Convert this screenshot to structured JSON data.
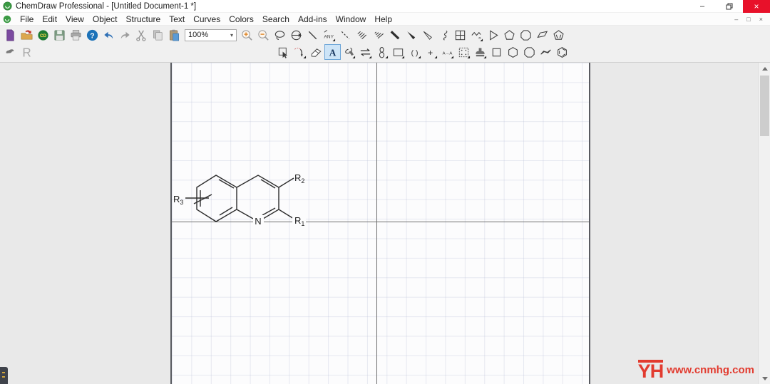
{
  "window": {
    "title": "ChemDraw Professional - [Untitled Document-1 *]",
    "controls": {
      "minimize": "–",
      "close": "×"
    }
  },
  "menubar": {
    "items": [
      "File",
      "Edit",
      "View",
      "Object",
      "Structure",
      "Text",
      "Curves",
      "Colors",
      "Search",
      "Add-ins",
      "Window",
      "Help"
    ],
    "mdi_controls": {
      "minimize": "–",
      "restore": "□",
      "close": "×"
    }
  },
  "toolbar": {
    "zoom_value": "100%",
    "row1_left": [
      {
        "n": "new-document"
      },
      {
        "n": "open-folder"
      },
      {
        "n": "chemdraw-cloud",
        "t": "CD"
      },
      {
        "n": "save"
      },
      {
        "n": "print"
      },
      {
        "n": "help",
        "t": "?"
      },
      {
        "n": "undo"
      },
      {
        "n": "redo"
      },
      {
        "n": "cut"
      },
      {
        "n": "copy"
      },
      {
        "n": "paste"
      }
    ],
    "row1_right": [
      {
        "n": "zoom-in"
      },
      {
        "n": "zoom-out"
      },
      {
        "n": "lasso-select"
      },
      {
        "n": "rotate-tool"
      },
      {
        "n": "solid-bond"
      },
      {
        "n": "any-bond",
        "t": "ANY",
        "f": 1
      },
      {
        "n": "dashed-bond"
      },
      {
        "n": "hashed-bond"
      },
      {
        "n": "hashed-wedge-bond"
      },
      {
        "n": "bold-bond"
      },
      {
        "n": "wedge-bond"
      },
      {
        "n": "hollow-wedge-bond"
      },
      {
        "n": "wavy-bond"
      },
      {
        "n": "table"
      },
      {
        "n": "repeat-unit",
        "t": "n",
        "f": 1
      },
      {
        "n": "cyclopropane-ring"
      },
      {
        "n": "cyclopentane-ring"
      },
      {
        "n": "cyclooctane-ring"
      },
      {
        "n": "variable-ring"
      },
      {
        "n": "cyclopentadiene-ring"
      }
    ],
    "row2_left": [
      {
        "n": "ink-tool"
      },
      {
        "n": "r-group",
        "t": "R"
      }
    ],
    "row2_right": [
      {
        "n": "marquee-select"
      },
      {
        "n": "curve-tool",
        "f": 1
      },
      {
        "n": "eraser"
      },
      {
        "n": "text-tool",
        "t": "A",
        "sel": 1
      },
      {
        "n": "pen-tool",
        "f": 1
      },
      {
        "n": "arrow-tool",
        "f": 1
      },
      {
        "n": "orbital-tool",
        "f": 1
      },
      {
        "n": "drawing-box",
        "f": 1
      },
      {
        "n": "brackets-tool",
        "t": "( )",
        "f": 1
      },
      {
        "n": "plus-tool",
        "t": "+",
        "f": 1
      },
      {
        "n": "atom-map-tool",
        "t": "A→A",
        "f": 1
      },
      {
        "n": "template-table",
        "f": 1
      },
      {
        "n": "stamp-tool",
        "f": 1
      },
      {
        "n": "cyclobutane-ring"
      },
      {
        "n": "cyclohexane-ring"
      },
      {
        "n": "cyclooctane-ring-2"
      },
      {
        "n": "chair-ring"
      },
      {
        "n": "benzene-ring"
      }
    ]
  },
  "structure": {
    "nitrogen": "N",
    "r": "R",
    "sub1": "1",
    "sub2": "2",
    "sub3": "3"
  },
  "watermark": {
    "logo": "YH",
    "url": "www.cnmhg.com"
  },
  "colors": {
    "close_red": "#e8112a",
    "watermark_red": "#e23b2f",
    "selection_blue": "#cde4f7",
    "page_border": "#595b60"
  }
}
